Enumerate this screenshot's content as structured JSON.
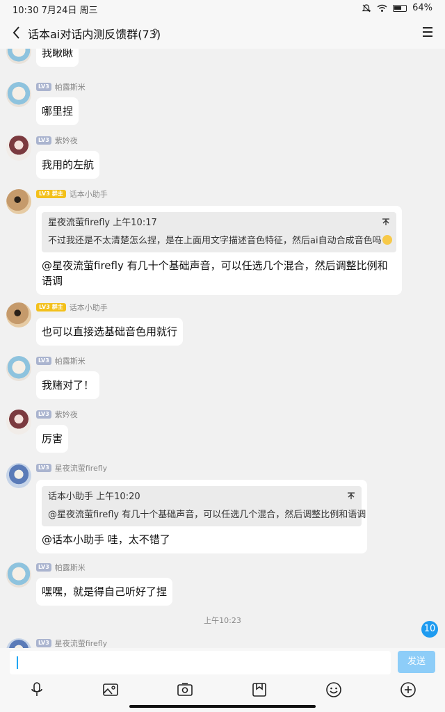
{
  "status_bar": {
    "time": "10:30 7月24日 周三",
    "battery": "64%"
  },
  "header": {
    "title": "话本ai对话内测反馈群(73)"
  },
  "messages": [
    {
      "text": "我瞅瞅"
    },
    {
      "level": "LV3",
      "name": "帕露斯米",
      "text": "哪里捏"
    },
    {
      "level": "LV3",
      "name": "紫妗夜",
      "text": "我用的左航"
    },
    {
      "level": "LV3",
      "role": "群主",
      "name": "话本小助手",
      "quote": {
        "author": "星夜流萤firefly",
        "time": "上午10:17",
        "text": "不过我还是不太清楚怎么捏，是在上面用文字描述音色特征，然后ai自动合成音色吗"
      },
      "text": "@星夜流萤firefly 有几十个基础声音，可以任选几个混合，然后调整比例和语调"
    },
    {
      "level": "LV3",
      "role": "群主",
      "name": "话本小助手",
      "text": "也可以直接选基础音色用就行"
    },
    {
      "level": "LV3",
      "name": "帕露斯米",
      "text": "我赌对了！"
    },
    {
      "level": "LV3",
      "name": "紫妗夜",
      "text": "厉害"
    },
    {
      "level": "LV3",
      "name": "星夜流萤firefly",
      "quote": {
        "author": "话本小助手",
        "time": "上午10:20",
        "text": "@星夜流萤firefly 有几十个基础声音，可以任选几个混合，然后调整比例和语调"
      },
      "text": "@话本小助手 哇，太不错了"
    },
    {
      "level": "LV3",
      "name": "帕露斯米",
      "text": "嘿嘿，就是得自己听好了捏"
    },
    {
      "level": "LV3",
      "name": "星夜流萤firefly"
    }
  ],
  "time_separator": "上午10:23",
  "unread_count": "10",
  "composer": {
    "send_label": "发送"
  },
  "toolbar_icons": [
    "mic-icon",
    "image-icon",
    "camera-icon",
    "file-icon",
    "emoji-icon",
    "plus-icon"
  ]
}
